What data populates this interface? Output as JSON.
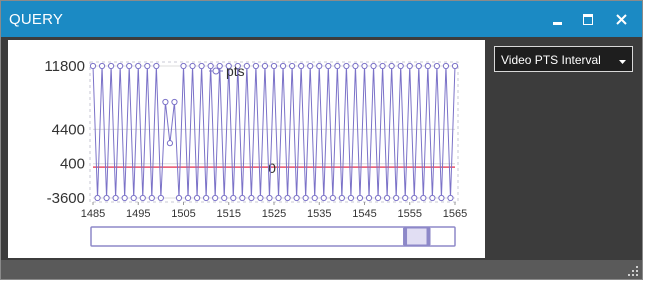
{
  "window": {
    "title": "QUERY",
    "minimize_icon": "minimize-icon",
    "maximize_icon": "maximize-icon",
    "close_icon": "close-icon",
    "accent": "#1b8ac4",
    "resize_grip_icon": "resize-grip-icon"
  },
  "dropdown": {
    "selected": "Video PTS Interval"
  },
  "chart_data": {
    "type": "line",
    "series": [
      {
        "name": "pts",
        "color": "#7b72c8",
        "x": [
          1485,
          1486,
          1487,
          1488,
          1489,
          1490,
          1491,
          1492,
          1493,
          1494,
          1495,
          1496,
          1497,
          1498,
          1499,
          1500,
          1501,
          1502,
          1503,
          1504,
          1505,
          1506,
          1507,
          1508,
          1509,
          1510,
          1511,
          1512,
          1513,
          1514,
          1515,
          1516,
          1517,
          1518,
          1519,
          1520,
          1521,
          1522,
          1523,
          1524,
          1525,
          1526,
          1527,
          1528,
          1529,
          1530,
          1531,
          1532,
          1533,
          1534,
          1535,
          1536,
          1537,
          1538,
          1539,
          1540,
          1541,
          1542,
          1543,
          1544,
          1545,
          1546,
          1547,
          1548,
          1549,
          1550,
          1551,
          1552,
          1553,
          1554,
          1555,
          1556,
          1557,
          1558,
          1559,
          1560,
          1561,
          1562,
          1563,
          1564,
          1565
        ],
        "values": [
          11800,
          -3600,
          11800,
          -3600,
          11800,
          -3600,
          11800,
          -3600,
          11800,
          -3600,
          11800,
          -3600,
          11800,
          -3600,
          11800,
          -3600,
          7600,
          2800,
          7600,
          -3600,
          11800,
          -3600,
          11800,
          -3600,
          11800,
          -3600,
          11800,
          -3600,
          11800,
          -3600,
          11800,
          -3600,
          11800,
          -3600,
          11800,
          -3600,
          11800,
          -3600,
          11800,
          -3600,
          11800,
          -3600,
          11800,
          -3600,
          11800,
          -3600,
          11800,
          -3600,
          11800,
          -3600,
          11800,
          -3600,
          11800,
          -3600,
          11800,
          -3600,
          11800,
          -3600,
          11800,
          -3600,
          11800,
          -3600,
          11800,
          -3600,
          11800,
          -3600,
          11800,
          -3600,
          11800,
          -3600,
          11800,
          -3600,
          11800,
          -3600,
          11800,
          -3600,
          11800,
          -3600,
          11800,
          -3600,
          11800
        ]
      },
      {
        "name": "0",
        "color": "#e8506a",
        "constant": 0
      }
    ],
    "yticks": [
      "11800",
      "4400",
      "400",
      "-3600"
    ],
    "ytick_values": [
      11800,
      4400,
      400,
      -3600
    ],
    "xticks": [
      "1485",
      "1495",
      "1505",
      "1515",
      "1525",
      "1535",
      "1545",
      "1555",
      "1565"
    ],
    "xtick_values": [
      1485,
      1495,
      1505,
      1515,
      1525,
      1535,
      1545,
      1555,
      1565
    ],
    "xlim": [
      1485,
      1565
    ],
    "ylim": [
      -3600,
      11800
    ],
    "grid": true,
    "legend_placement": "top-center",
    "scrollbar": {
      "position": 0.86,
      "thumb_fraction": 0.07
    }
  }
}
